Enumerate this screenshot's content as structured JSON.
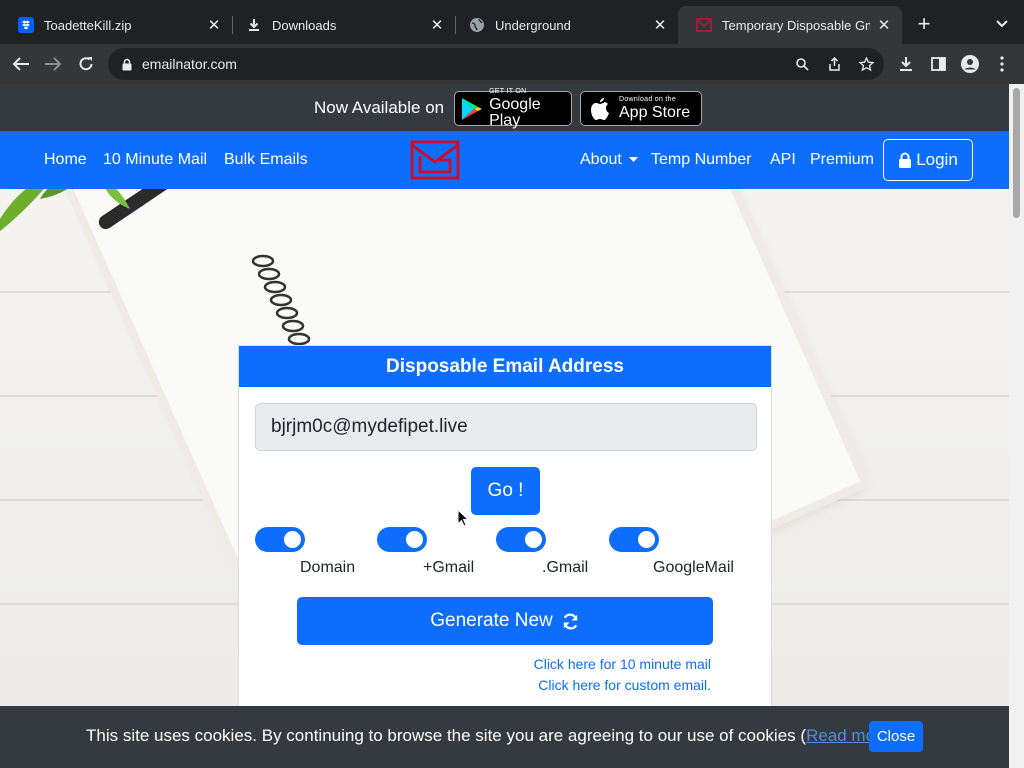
{
  "browser": {
    "tabs": [
      {
        "title": "ToadetteKill.zip",
        "icon": "dropbox-icon",
        "active": false
      },
      {
        "title": "Downloads",
        "icon": "download-icon",
        "active": false
      },
      {
        "title": "Underground",
        "icon": "globe-icon",
        "active": false
      },
      {
        "title": "Temporary Disposable Gmai",
        "icon": "emailnator-favicon",
        "active": true
      }
    ],
    "url": "emailnator.com"
  },
  "promo": {
    "text": "Now Available on",
    "google_play": {
      "small": "GET IT ON",
      "big": "Google Play"
    },
    "app_store": {
      "small": "Download on the",
      "big": "App Store"
    }
  },
  "nav": {
    "left": [
      "Home",
      "10 Minute Mail",
      "Bulk Emails"
    ],
    "right": [
      "About",
      "Temp Number",
      "API",
      "Premium"
    ],
    "login": "Login"
  },
  "card": {
    "title": "Disposable Email Address",
    "email": "bjrjm0c@mydefipet.live",
    "go": "Go !",
    "toggles": [
      {
        "label": "Domain",
        "on": true
      },
      {
        "label": "+Gmail",
        "on": true
      },
      {
        "label": ".Gmail",
        "on": true
      },
      {
        "label": "GoogleMail",
        "on": true
      }
    ],
    "generate": "Generate New",
    "link_10min": "Click here for 10 minute mail",
    "link_custom": "Click here for custom email."
  },
  "cookie": {
    "text": "This site uses cookies. By continuing to browse the site you are agreeing to our use of cookies (",
    "read_more": "Read more",
    "after": ")",
    "close": "Close"
  },
  "colors": {
    "brand_blue": "#0d6efd",
    "dark_bar": "#343a40",
    "logo_red": "#c8102e"
  }
}
